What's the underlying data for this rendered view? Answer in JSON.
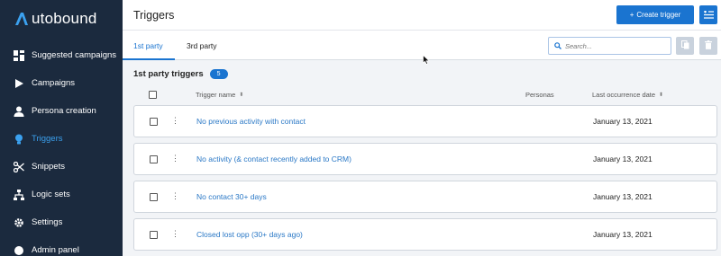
{
  "app": {
    "logo_text": "utobound",
    "logo_color": "#3ba1ef"
  },
  "sidebar": {
    "items": [
      {
        "label": "Suggested campaigns",
        "icon": "grid-icon",
        "active": false
      },
      {
        "label": "Campaigns",
        "icon": "play-icon",
        "active": false
      },
      {
        "label": "Persona creation",
        "icon": "person-icon",
        "active": false
      },
      {
        "label": "Triggers",
        "icon": "lightbulb-icon",
        "active": true
      },
      {
        "label": "Snippets",
        "icon": "scissors-icon",
        "active": false
      },
      {
        "label": "Logic sets",
        "icon": "sitemap-icon",
        "active": false
      },
      {
        "label": "Settings",
        "icon": "gear-icon",
        "active": false
      },
      {
        "label": "Admin panel",
        "icon": "admin-icon",
        "active": false
      }
    ]
  },
  "header": {
    "title": "Triggers",
    "create_label": "Create trigger",
    "create_icon": "plus-icon",
    "side_button_icon": "filter-list-icon"
  },
  "tabs": [
    {
      "label": "1st party",
      "active": true
    },
    {
      "label": "3rd party",
      "active": false
    }
  ],
  "search": {
    "placeholder": "Search..."
  },
  "section": {
    "title": "1st party triggers",
    "count": "5"
  },
  "table": {
    "columns": [
      "Trigger name",
      "Personas",
      "Last occurrence date"
    ],
    "rows": [
      {
        "name": "No previous activity with contact",
        "personas": "",
        "date": "January 13, 2021"
      },
      {
        "name": "No activity (& contact recently added to CRM)",
        "personas": "",
        "date": "January 13, 2021"
      },
      {
        "name": "No contact 30+ days",
        "personas": "",
        "date": "January 13, 2021"
      },
      {
        "name": "Closed lost opp (30+ days ago)",
        "personas": "",
        "date": "January 13, 2021"
      }
    ]
  },
  "colors": {
    "sidebar_bg": "#1b2a3e",
    "accent": "#1a74d0",
    "link": "#2a78c6"
  }
}
